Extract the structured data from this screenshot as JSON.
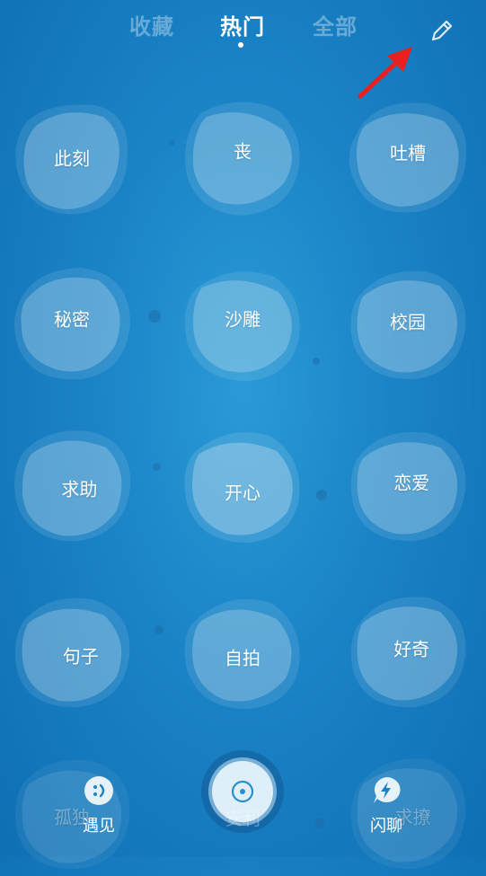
{
  "tabs": {
    "favorites": "收藏",
    "hot": "热门",
    "all": "全部"
  },
  "topics": [
    {
      "label": "此刻"
    },
    {
      "label": "丧"
    },
    {
      "label": "吐槽"
    },
    {
      "label": "秘密"
    },
    {
      "label": "沙雕"
    },
    {
      "label": "校园"
    },
    {
      "label": "求助"
    },
    {
      "label": "开心"
    },
    {
      "label": "恋爱"
    },
    {
      "label": "句子"
    },
    {
      "label": "自拍"
    },
    {
      "label": "好奇"
    },
    {
      "label": "孤独"
    },
    {
      "label": "安利"
    },
    {
      "label": "求撩"
    }
  ],
  "bottom_nav": {
    "left_label": "遇见",
    "right_label": "闪聊"
  },
  "icons": {
    "edit": "pencil-icon",
    "meet": "smiley-icon",
    "chat": "lightning-bubble-icon",
    "center": "target-icon"
  },
  "colors": {
    "background": "#1a83c6",
    "annotation": "#e8201e"
  }
}
